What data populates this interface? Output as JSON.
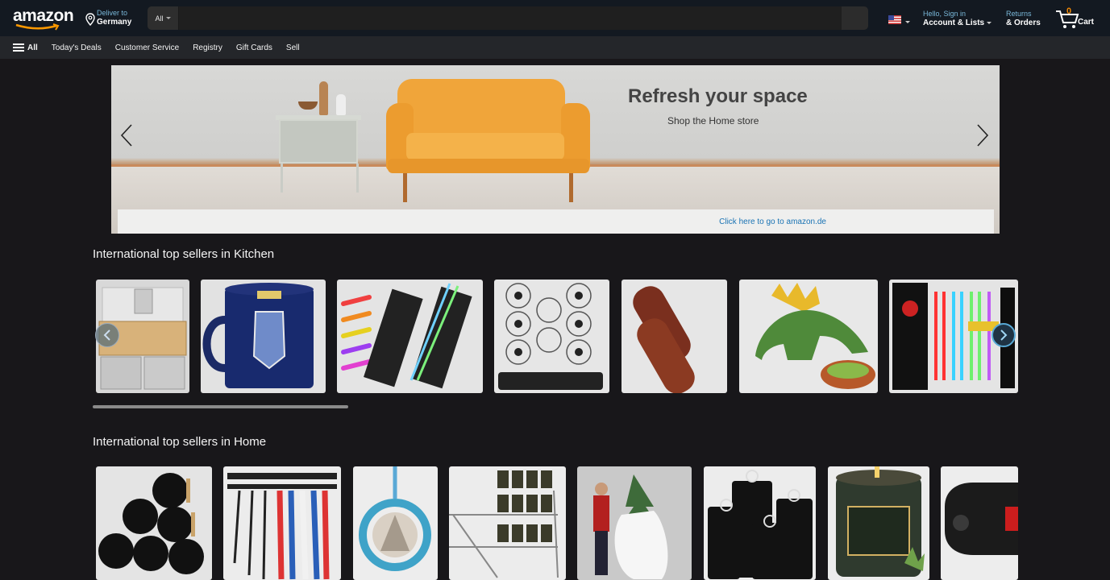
{
  "header": {
    "logo_text": "amazon",
    "deliver_to": "Deliver to",
    "deliver_location": "Germany",
    "search_category": "All",
    "search_placeholder": "",
    "account_greeting": "Hello, Sign in",
    "account_label": "Account & Lists",
    "returns_label": "Returns",
    "orders_label": "& Orders",
    "cart_count": "0",
    "cart_label": "Cart"
  },
  "subnav": {
    "all_label": "All",
    "items": [
      "Today's Deals",
      "Customer Service",
      "Registry",
      "Gift Cards",
      "Sell"
    ]
  },
  "hero": {
    "title": "Refresh your space",
    "subtitle": "Shop the Home store",
    "notice_link": "Click here to go to amazon.de"
  },
  "rows": [
    {
      "title": "International top sellers in Kitchen",
      "products": [
        {
          "icon": "cutting-board-bins"
        },
        {
          "icon": "police-mug"
        },
        {
          "icon": "light-up-chopsticks"
        },
        {
          "icon": "whisk-set"
        },
        {
          "icon": "wooden-handles"
        },
        {
          "icon": "dinosaur-chip-dip"
        },
        {
          "icon": "lightsaber-chopsticks"
        }
      ]
    },
    {
      "title": "International top sellers in Home",
      "products": [
        {
          "icon": "black-yarn-spools"
        },
        {
          "icon": "ski-wall-rack"
        },
        {
          "icon": "christmas-ornament"
        },
        {
          "icon": "spice-rack"
        },
        {
          "icon": "tree-storage-bag"
        },
        {
          "icon": "ring-display-stands"
        },
        {
          "icon": "scented-candle-tin"
        },
        {
          "icon": "digital-clock"
        }
      ]
    }
  ],
  "colors": {
    "topbar": "#131921",
    "subnav": "#24262a",
    "page_bg": "#18171a",
    "link": "#79b7d8",
    "cart_count": "#f08804"
  }
}
